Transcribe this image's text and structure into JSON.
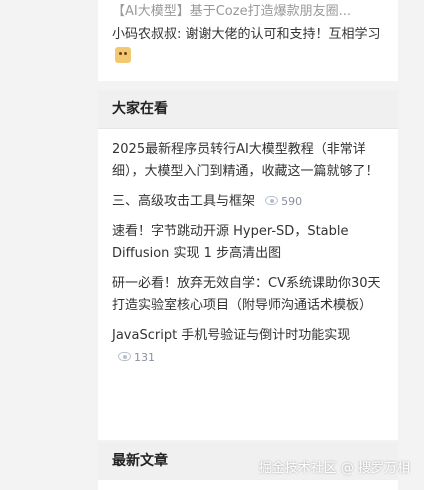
{
  "top_card": {
    "title": "【AI大模型】基于Coze打造爆款朋友圈...",
    "reply": "小码农叔叔: 谢谢大佬的认可和支持！互相学习"
  },
  "hot_section": {
    "heading": "大家在看",
    "items": [
      {
        "title": "2025最新程序员转行AI大模型教程（非常详细），大模型入门到精通，收藏这一篇就够了！",
        "views": ""
      },
      {
        "title": "三、高级攻击工具与框架",
        "views": "590"
      },
      {
        "title": "速看！字节跳动开源 Hyper-SD，Stable Diffusion 实现 1 步高清出图",
        "views": ""
      },
      {
        "title": "研一必看！放弃无效自学：CV系统课助你30天打造实验室核心项目（附导师沟通话术模板）",
        "views": ""
      },
      {
        "title": "JavaScript 手机号验证与倒计时功能实现",
        "views": "131"
      }
    ]
  },
  "new_section": {
    "heading": "最新文章"
  },
  "watermark": "掘金技术社区 @ 搜罗万相"
}
